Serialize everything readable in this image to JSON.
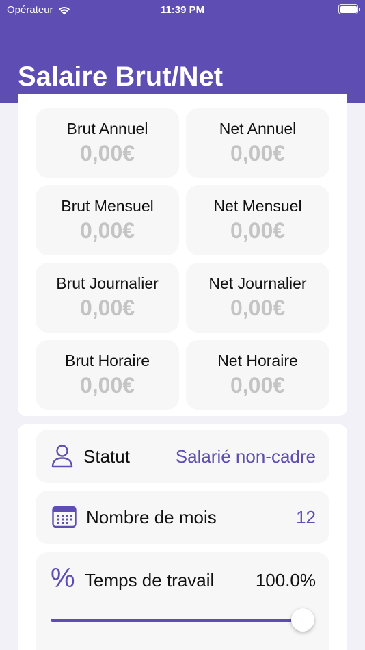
{
  "status_bar": {
    "carrier": "Opérateur",
    "time": "11:39 PM"
  },
  "header": {
    "title": "Salaire Brut/Net",
    "color": "#5e4db2"
  },
  "results": [
    {
      "label": "Brut Annuel",
      "value": "0,00€"
    },
    {
      "label": "Net Annuel",
      "value": "0,00€"
    },
    {
      "label": "Brut Mensuel",
      "value": "0,00€"
    },
    {
      "label": "Net Mensuel",
      "value": "0,00€"
    },
    {
      "label": "Brut Journalier",
      "value": "0,00€"
    },
    {
      "label": "Net Journalier",
      "value": "0,00€"
    },
    {
      "label": "Brut Horaire",
      "value": "0,00€"
    },
    {
      "label": "Net Horaire",
      "value": "0,00€"
    }
  ],
  "settings": {
    "statut": {
      "label": "Statut",
      "value": "Salarié non-cadre",
      "icon": "person-icon"
    },
    "mois": {
      "label": "Nombre de mois",
      "value": "12",
      "icon": "calendar-icon"
    },
    "temps": {
      "label": "Temps de travail",
      "value": "100.0%",
      "icon": "percent-icon",
      "slider_fraction": 1.0
    }
  },
  "accent_color": "#5e4db2"
}
